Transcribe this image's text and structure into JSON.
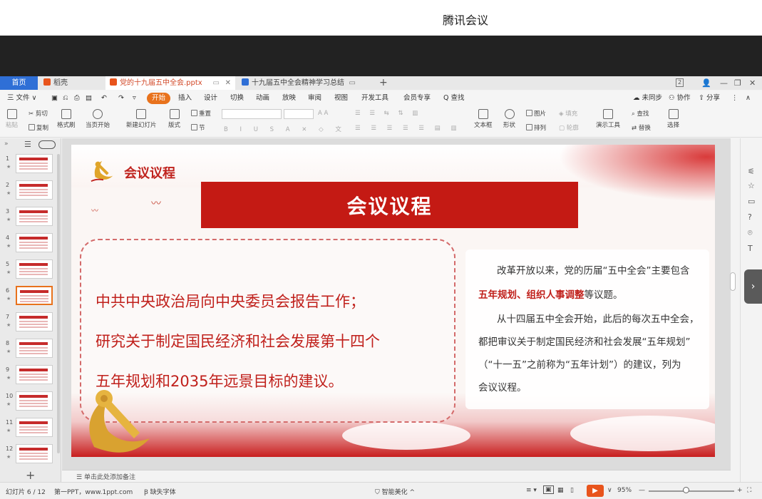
{
  "meeting": {
    "title": "腾讯会议"
  },
  "tabs": {
    "home": "首页",
    "store": "稻壳",
    "doc1": "党的十九届五中全会.pptx",
    "doc2": "十九届五中全会精神学习总结",
    "plus": "+",
    "badge": "2"
  },
  "menu": {
    "file": "三 文件 ∨",
    "items": [
      "开始",
      "插入",
      "设计",
      "切换",
      "动画",
      "放映",
      "审阅",
      "视图",
      "开发工具",
      "会员专享"
    ],
    "search": "Q 查找",
    "unsynced": "未同步",
    "collab": "协作",
    "share": "分享"
  },
  "toolbar": {
    "paste": "粘贴",
    "cut": "剪切",
    "copy": "复制",
    "format_painter": "格式刷",
    "start_from_current": "当页开始",
    "new_slide": "新建幻灯片",
    "layout": "版式",
    "reset": "重置",
    "section": "节",
    "text_box": "文本框",
    "shape": "形状",
    "picture": "图片",
    "arrange": "排列",
    "fill": "填充",
    "outline": "轮廓",
    "present_tools": "演示工具",
    "find": "查找",
    "replace": "替换",
    "select": "选择"
  },
  "thumbnails": {
    "count": 12,
    "selected": 6,
    "numbers": [
      "1",
      "2",
      "3",
      "4",
      "5",
      "6",
      "7",
      "8",
      "9",
      "10",
      "11",
      "12"
    ]
  },
  "slide": {
    "corner_label": "会议议程",
    "title": "会议议程",
    "left_lines": [
      "中共中央政治局向中央委员会报告工作；",
      "研究关于制定国民经济和社会发展第十四个",
      "五年规划和2035年远景目标的建议。"
    ],
    "right_l1": "改革开放以来，党的历届“五中全会”主要包含",
    "right_l2_red": "五年规划、组织人事调整",
    "right_l2_rest": "等议题。",
    "right_l3": "从十四届五中全会开始，此后的每次五中全会，",
    "right_l4": "都把审议关于制定国民经济和社会发展“五年规划”",
    "right_l5": "（“十一五”之前称为“五年计划”）的建议，列为",
    "right_l6": "会议议程。"
  },
  "notes": {
    "placeholder": "单击此处添加备注"
  },
  "status": {
    "slide_indicator": "幻灯片 6 / 12",
    "template": "第一PPT，www.1ppt.com",
    "missing_font": "缺失字体",
    "smart_beautify": "智能美化",
    "zoom": "95%"
  },
  "colors": {
    "accent_orange": "#e8721c",
    "title_red": "#c41a14",
    "text_red": "#c0201b",
    "home_tab_blue": "#2f6fd6"
  }
}
